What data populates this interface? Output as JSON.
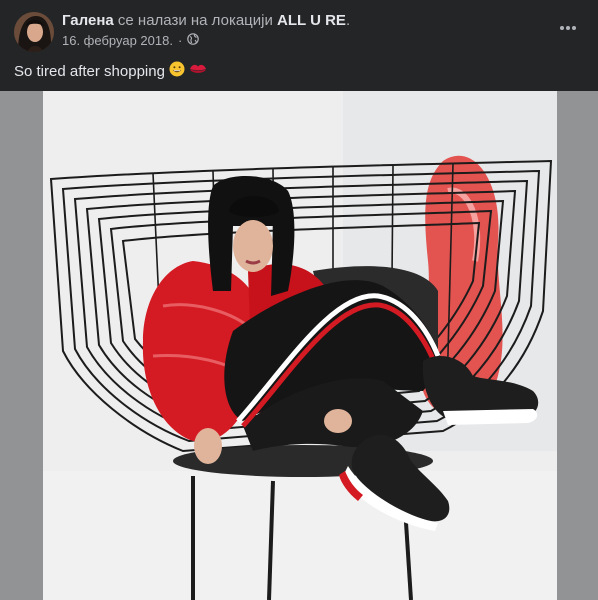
{
  "post": {
    "author": "Галена",
    "location_prefix": "се налази на локацији",
    "location": "ALL U RE",
    "location_suffix": ".",
    "date": "16. фебруар 2018.",
    "date_separator": "·",
    "privacy_icon": "globe-icon",
    "more_icon": "more-horizontal-icon",
    "caption": "So tired after shopping",
    "caption_emojis": [
      "grinning-face",
      "kiss-mark"
    ]
  },
  "colors": {
    "background": "#242526",
    "text_primary": "#e4e6eb",
    "text_secondary": "#b0b3b8",
    "photo_backdrop": "#929394"
  }
}
